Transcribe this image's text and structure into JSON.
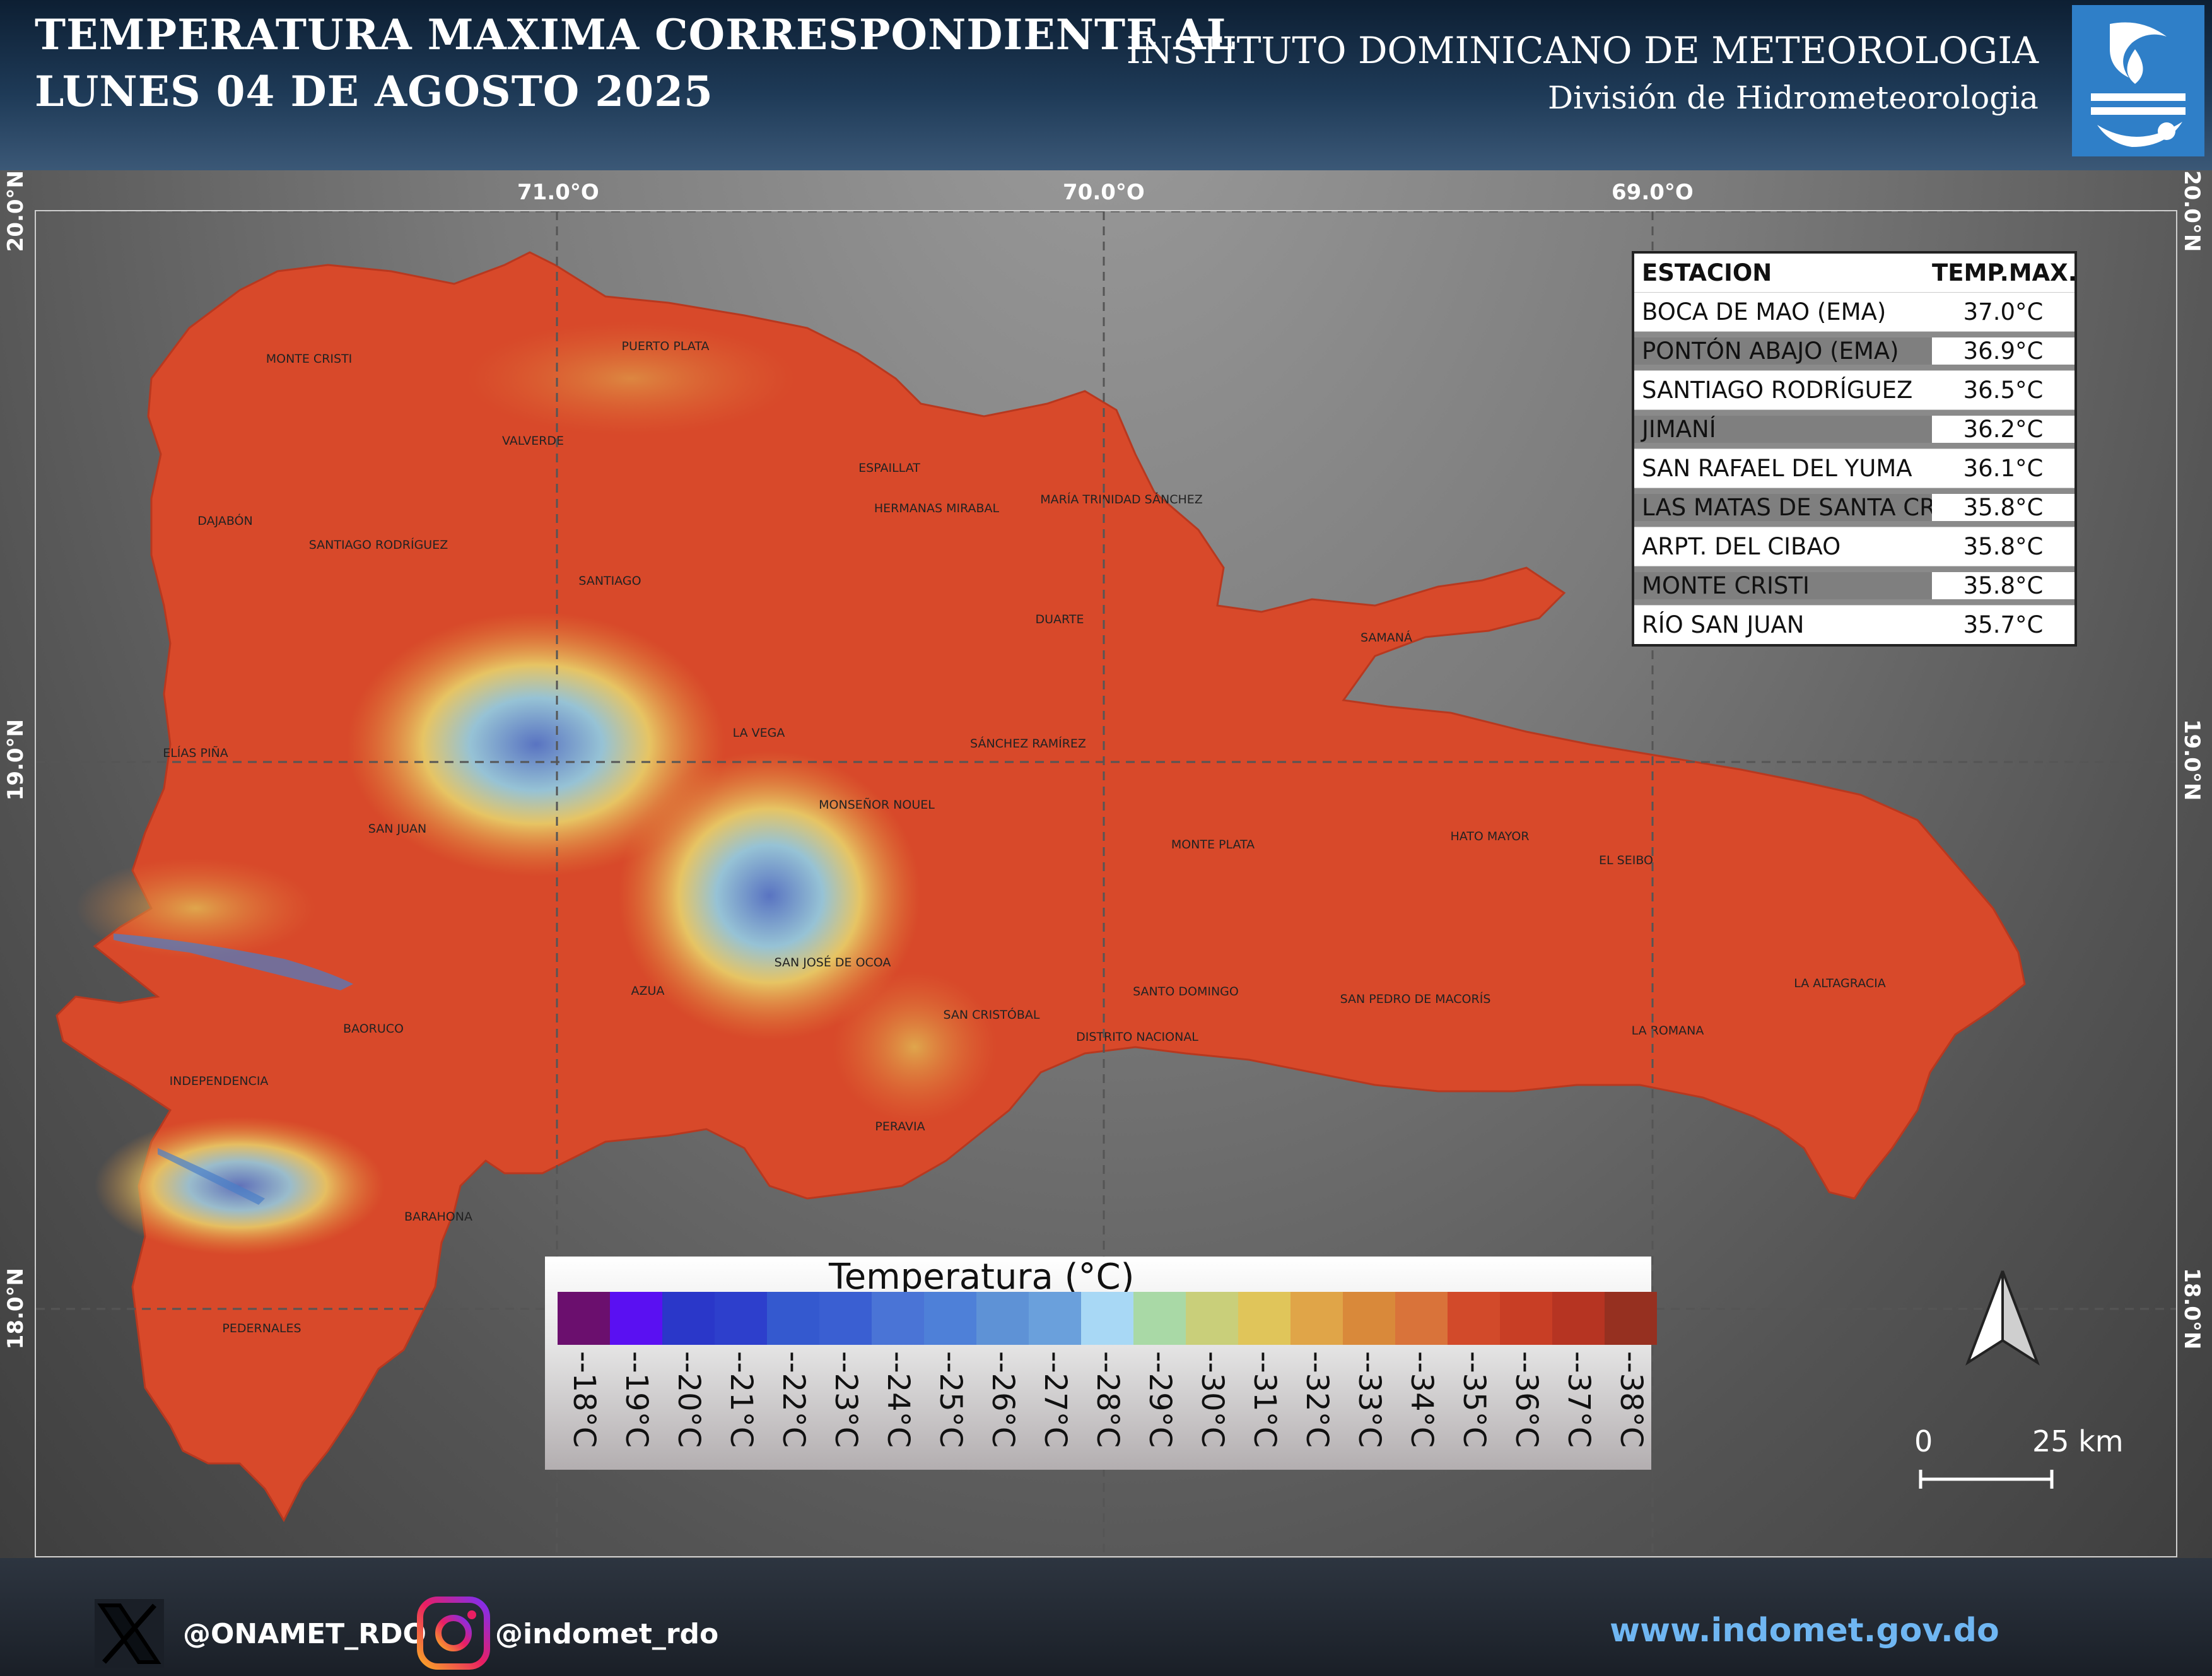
{
  "header": {
    "title_line1": "TEMPERATURA MAXIMA CORRESPONDIENTE AL",
    "title_line2": "LUNES 04 DE AGOSTO 2025",
    "institute": "INSTITUTO DOMINICANO DE METEOROLOGIA",
    "division": "División de Hidrometeorologia"
  },
  "grid": {
    "lon_labels": [
      "71.0°O",
      "70.0°O",
      "69.0°O"
    ],
    "lat_labels": [
      "20.0°N",
      "19.0°N",
      "18.0°N"
    ]
  },
  "table": {
    "header_station": "ESTACION",
    "header_temp": "TEMP.MAX.",
    "rows": [
      {
        "station": "BOCA DE MAO (EMA)",
        "temp": "37.0°C"
      },
      {
        "station": "PONTÓN ABAJO (EMA)",
        "temp": "36.9°C"
      },
      {
        "station": "SANTIAGO RODRÍGUEZ",
        "temp": "36.5°C"
      },
      {
        "station": "JIMANÍ",
        "temp": "36.2°C"
      },
      {
        "station": "SAN RAFAEL DEL YUMA",
        "temp": "36.1°C"
      },
      {
        "station": "LAS MATAS DE SANTA CRUZ",
        "temp": "35.8°C"
      },
      {
        "station": "ARPT. DEL CIBAO",
        "temp": "35.8°C"
      },
      {
        "station": "MONTE CRISTI",
        "temp": "35.8°C"
      },
      {
        "station": "RÍO SAN JUAN",
        "temp": "35.7°C"
      }
    ]
  },
  "provinces": [
    "MONTE CRISTI",
    "PUERTO PLATA",
    "VALVERDE",
    "ESPAILLAT",
    "HERMANAS MIRABAL",
    "MARÍA TRINIDAD SÁNCHEZ",
    "DAJABÓN",
    "SANTIAGO RODRÍGUEZ",
    "SANTIAGO",
    "DUARTE",
    "SAMANÁ",
    "ELÍAS PIÑA",
    "LA VEGA",
    "SÁNCHEZ RAMÍREZ",
    "MONSEÑOR NOUEL",
    "SAN JUAN",
    "MONTE PLATA",
    "HATO MAYOR",
    "EL SEIBO",
    "AZUA",
    "SAN JOSÉ DE OCOA",
    "SAN CRISTÓBAL",
    "SANTO DOMINGO",
    "DISTRITO NACIONAL",
    "SAN PEDRO DE MACORÍS",
    "LA ROMANA",
    "LA ALTAGRACIA",
    "BAORUCO",
    "INDEPENDENCIA",
    "PERAVIA",
    "BARAHONA",
    "PEDERNALES"
  ],
  "legend": {
    "title": "Temperatura (°C)",
    "labels": [
      "--18°C",
      "--19°C",
      "--20°C",
      "--21°C",
      "--22°C",
      "--23°C",
      "--24°C",
      "--25°C",
      "--26°C",
      "--27°C",
      "--28°C",
      "--29°C",
      "--30°C",
      "--31°C",
      "--32°C",
      "--33°C",
      "--34°C",
      "--35°C",
      "--36°C",
      "--37°C",
      "--38°C"
    ],
    "colors": [
      "#6b0f6e",
      "#5a10f2",
      "#2a37c9",
      "#2d3fcc",
      "#3459cf",
      "#3a5fd2",
      "#4a74d6",
      "#4e80d8",
      "#5e92d6",
      "#6aa0dc",
      "#a8d8f5",
      "#a9d9a6",
      "#c9cf7a",
      "#e0c55a",
      "#e0a548",
      "#d9893a",
      "#d9733a",
      "#d24a2a",
      "#c83e25",
      "#b63422",
      "#963020"
    ]
  },
  "scale": {
    "zero": "0",
    "distance": "25 km"
  },
  "footer": {
    "twitter": "@ONAMET_RDO",
    "instagram": "@indomet_rdo",
    "website": "www.indomet.gov.do"
  }
}
